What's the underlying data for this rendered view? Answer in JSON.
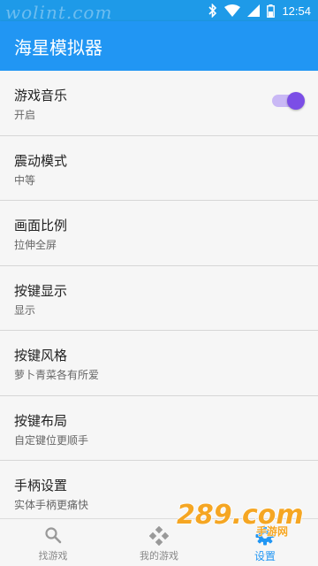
{
  "status_bar": {
    "watermark": "wolint.com",
    "time": "12:54",
    "icons": [
      "bluetooth-icon",
      "wifi-icon",
      "signal-icon",
      "battery-icon"
    ]
  },
  "app_bar": {
    "title": "海星模拟器"
  },
  "settings": [
    {
      "title": "游戏音乐",
      "subtitle": "开启",
      "toggle": true
    },
    {
      "title": "震动模式",
      "subtitle": "中等"
    },
    {
      "title": "画面比例",
      "subtitle": "拉伸全屏"
    },
    {
      "title": "按键显示",
      "subtitle": "显示"
    },
    {
      "title": "按键风格",
      "subtitle": "萝卜青菜各有所爱"
    },
    {
      "title": "按键布局",
      "subtitle": "自定键位更顺手"
    },
    {
      "title": "手柄设置",
      "subtitle": "实体手柄更痛快"
    }
  ],
  "bottom_nav": [
    {
      "label": "找游戏",
      "icon": "search-icon"
    },
    {
      "label": "我的游戏",
      "icon": "gamepad-icon"
    },
    {
      "label": "设置",
      "icon": "gear-icon",
      "active": true
    }
  ],
  "watermark_logo": {
    "text": "289.com",
    "subtext": "手游网"
  },
  "colors": {
    "primary": "#2196f3",
    "status_bar": "#1e9ae8",
    "toggle_on": "#7b4ee6",
    "logo_orange": "#f5a623"
  }
}
